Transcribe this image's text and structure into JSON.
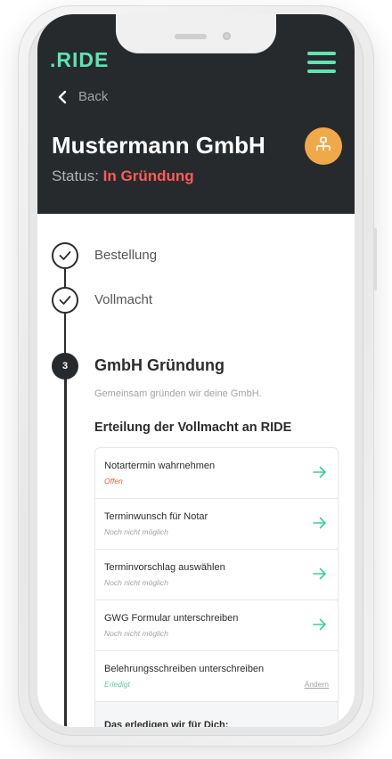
{
  "app": {
    "logo": ".RIDE",
    "back_label": "Back",
    "company_name": "Mustermann GmbH",
    "status_prefix": "Status:",
    "status_value": "In Gründung"
  },
  "colors": {
    "header_bg": "#272a2c",
    "accent": "#5fe3b2",
    "status_red": "#ff5a5a",
    "avatar_bg": "#f0a94a",
    "status_open": "#e8623a",
    "status_muted": "#a0a4a7",
    "status_done": "#5fc8a8"
  },
  "steps": {
    "completed": [
      {
        "label": "Bestellung",
        "icon": "check-icon"
      },
      {
        "label": "Vollmacht",
        "icon": "check-icon"
      }
    ],
    "current": {
      "number": "3",
      "title": "GmbH Gründung",
      "subtitle": "Gemeinsam gründen wir deine GmbH."
    }
  },
  "card": {
    "title": "Erteilung der Vollmacht an RIDE",
    "tasks": [
      {
        "title": "Notartermin wahrnehmen",
        "status": "Offen",
        "status_type": "open",
        "action": "arrow-right-icon"
      },
      {
        "title": "Terminwunsch für Notar",
        "status": "Noch nicht möglich",
        "status_type": "muted",
        "action": "arrow-right-icon"
      },
      {
        "title": "Terminvorschlag auswählen",
        "status": "Noch nicht möglich",
        "status_type": "muted",
        "action": "arrow-right-icon"
      },
      {
        "title": "GWG Formular unterschreiben",
        "status": "Noch nicht möglich",
        "status_type": "muted",
        "action": "arrow-right-icon"
      },
      {
        "title": "Belehrungsschreiben unterschreiben",
        "status": "Erledigt",
        "status_type": "done",
        "link": "Ändern"
      }
    ],
    "footer": "Das erledigen wir für Dich:"
  }
}
